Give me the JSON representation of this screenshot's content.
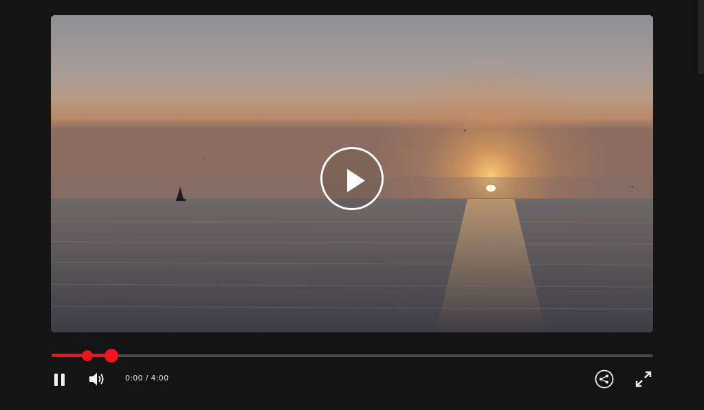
{
  "player": {
    "time_display": "0:00 / 4:00",
    "progress_fraction": 0.099,
    "buffered_fraction": 0.059,
    "accent_color": "#e8161e"
  },
  "icons": {
    "big_play": "play-icon",
    "pause": "pause-icon",
    "volume": "volume-icon",
    "share": "share-icon",
    "fullscreen": "fullscreen-icon"
  }
}
